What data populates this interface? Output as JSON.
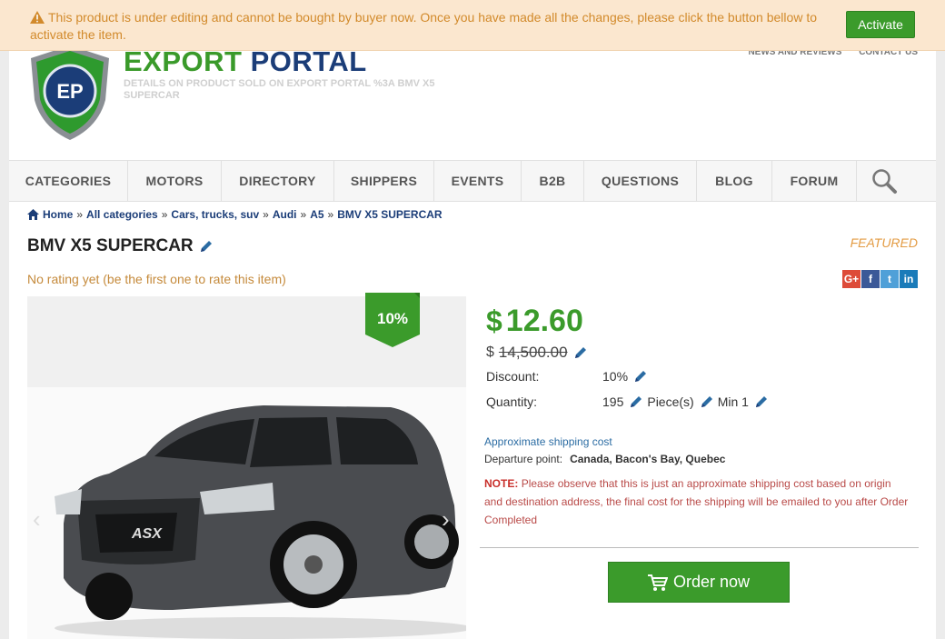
{
  "notice": {
    "message": "This product is under editing and cannot be bought by buyer now. Once you have made all the changes, please click the button bellow to activate the item.",
    "button": "Activate"
  },
  "top_links": [
    "NEWS AND REVIEWS",
    "CONTACT US"
  ],
  "brand": {
    "part1": "EXPORT",
    "part2": "PORTAL",
    "logo_letters": "EP",
    "tagline": "DETAILS ON PRODUCT SOLD ON EXPORT PORTAL %3A BMV X5 SUPERCAR"
  },
  "nav": [
    "CATEGORIES",
    "MOTORS",
    "DIRECTORY",
    "SHIPPERS",
    "EVENTS",
    "B2B",
    "QUESTIONS",
    "BLOG",
    "FORUM"
  ],
  "breadcrumb": [
    "Home",
    "All categories",
    "Cars, trucks, suv",
    "Audi",
    "A5",
    "BMV X5 SUPERCAR"
  ],
  "product": {
    "title": "BMV X5 SUPERCAR",
    "featured": "FEATURED",
    "rating": "No rating yet (be the first one to rate this item)",
    "discount_badge": "10%",
    "price_currency": "$",
    "price": "12.60",
    "old_currency": "$",
    "old_price": "14,500.00",
    "discount_label": "Discount:",
    "discount_value": "10%",
    "quantity_label": "Quantity:",
    "quantity_value": "195",
    "unit": "Piece(s)",
    "min_label": "Min 1",
    "shipping_link": "Approximate shipping cost",
    "departure_label": "Departure point:",
    "departure_value": "Canada, Bacon's Bay, Quebec",
    "note_label": "NOTE:",
    "note_text": "Please observe that this is just an approximate shipping cost based on origin and destination address, the final cost for the shipping will be emailed to you after Order Completed",
    "order_button": "Order now",
    "car_badge": "ASX"
  },
  "share": [
    "G+",
    "f",
    "t",
    "in"
  ],
  "colors": {
    "green": "#3b9b2b",
    "navy": "#1b3d78",
    "notice_bg": "#fbe7cf",
    "featured": "#e39b43"
  }
}
